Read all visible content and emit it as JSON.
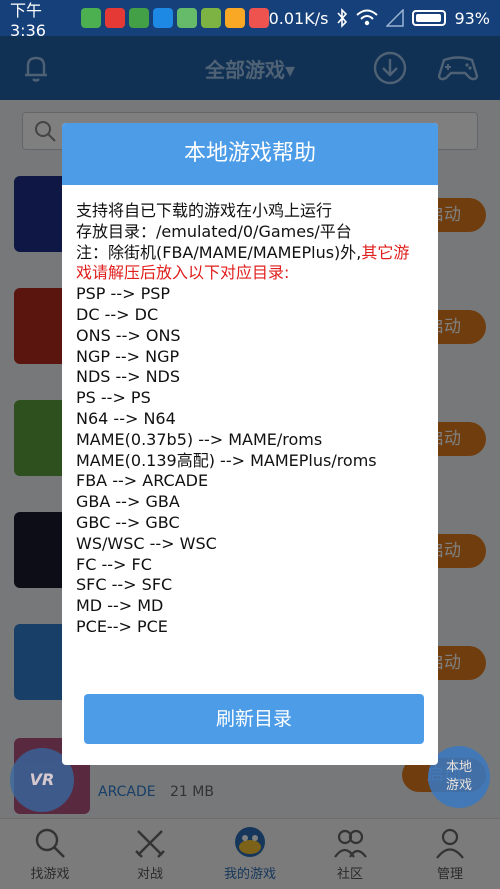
{
  "status_bar": {
    "time": "下午3:36",
    "network_speed": "0.01K/s",
    "battery": "93%",
    "app_icons": [
      {
        "name": "app-icon-green",
        "color": "#4caf50"
      },
      {
        "name": "app-icon-red-5",
        "color": "#e53935"
      },
      {
        "name": "app-icon-green2",
        "color": "#43a047"
      },
      {
        "name": "app-icon-blue",
        "color": "#1e88e5"
      },
      {
        "name": "app-icon-green3",
        "color": "#66bb6a"
      },
      {
        "name": "app-icon-green4",
        "color": "#7cb342"
      },
      {
        "name": "app-icon-yellow",
        "color": "#f9a825"
      },
      {
        "name": "app-icon-red2",
        "color": "#ef5350"
      }
    ]
  },
  "header": {
    "title": "全部游戏",
    "dropdown_glyph": "▾"
  },
  "list": {
    "start_label": "启动",
    "bottom_item": {
      "tag": "ARCADE",
      "size": "21 MB"
    }
  },
  "dialog": {
    "title": "本地游戏帮助",
    "intro_line1": "支持将自已下载的游戏在小鸡上运行",
    "intro_line2": "存放目录：/emulated/0/Games/平台",
    "note_black": "注：除街机(FBA/MAME/MAMEPlus)外,",
    "note_red": "其它游戏请解压后放入以下对应目录:",
    "mappings": [
      "PSP --> PSP",
      "DC --> DC",
      "ONS --> ONS",
      "NGP --> NGP",
      "NDS --> NDS",
      "PS --> PS",
      "N64 --> N64",
      "MAME(0.37b5) --> MAME/roms",
      "MAME(0.139高配) --> MAMEPlus/roms",
      "FBA --> ARCADE",
      "GBA --> GBA",
      "GBC --> GBC",
      "WS/WSC --> WSC",
      "FC --> FC",
      "SFC --> SFC",
      "MD --> MD",
      "PCE--> PCE"
    ],
    "refresh_label": "刷新目录"
  },
  "floating": {
    "vr_label": "VR",
    "local_line1": "本地",
    "local_line2": "游戏"
  },
  "bottom_nav": [
    {
      "label": "找游戏",
      "icon": "search-icon",
      "active": false
    },
    {
      "label": "对战",
      "icon": "crossed-swords-icon",
      "active": false
    },
    {
      "label": "我的游戏",
      "icon": "gamepad-chick-icon",
      "active": true
    },
    {
      "label": "社区",
      "icon": "community-icon",
      "active": false
    },
    {
      "label": "管理",
      "icon": "user-icon",
      "active": false
    }
  ],
  "colors": {
    "status_bar": "#16407a",
    "header": "#2163a8",
    "dialog_accent": "#4c9ce8",
    "warning_text": "#e0201e",
    "start_button": "#e07b1f",
    "nav_active": "#2c6fb6"
  }
}
